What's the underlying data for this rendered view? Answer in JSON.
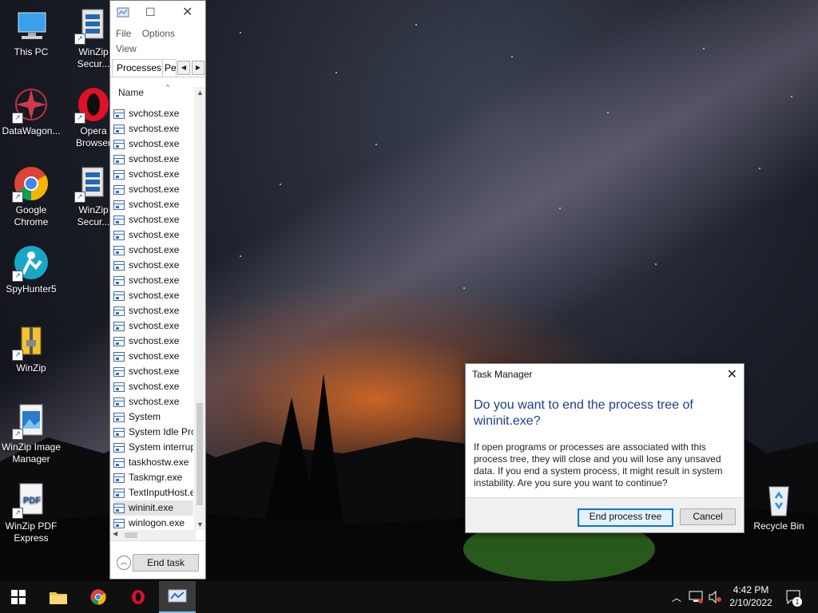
{
  "desktop": {
    "icons": [
      {
        "label": "This PC",
        "icon": "this-pc-icon"
      },
      {
        "label": "WinZip Secur...",
        "icon": "winzip-secure-icon"
      },
      {
        "label": "DataWagon...",
        "icon": "datawagon-icon"
      },
      {
        "label": "Opera Browser",
        "icon": "opera-icon"
      },
      {
        "label": "Google Chrome",
        "icon": "chrome-icon"
      },
      {
        "label": "WinZip Secur...",
        "icon": "winzip-secure-icon"
      },
      {
        "label": "SpyHunter5",
        "icon": "spyhunter-icon"
      },
      {
        "label": "WinZip",
        "icon": "winzip-icon"
      },
      {
        "label": "WinZip Image Manager",
        "icon": "winzip-image-manager-icon"
      },
      {
        "label": "WinZip PDF Express",
        "icon": "winzip-pdf-icon"
      },
      {
        "label": "Recycle Bin",
        "icon": "recycle-bin-icon"
      }
    ]
  },
  "task_manager": {
    "menu": [
      "File",
      "Options",
      "View"
    ],
    "tabs": [
      "Processes",
      "Pe"
    ],
    "column_name": "Name",
    "processes": [
      "svchost.exe",
      "svchost.exe",
      "svchost.exe",
      "svchost.exe",
      "svchost.exe",
      "svchost.exe",
      "svchost.exe",
      "svchost.exe",
      "svchost.exe",
      "svchost.exe",
      "svchost.exe",
      "svchost.exe",
      "svchost.exe",
      "svchost.exe",
      "svchost.exe",
      "svchost.exe",
      "svchost.exe",
      "svchost.exe",
      "svchost.exe",
      "svchost.exe",
      "System",
      "System Idle Pro",
      "System interrup",
      "taskhostw.exe",
      "Taskmgr.exe",
      "TextInputHost.e",
      "wininit.exe",
      "winlogon.exe"
    ],
    "selected_process": "wininit.exe",
    "end_task_label": "End task"
  },
  "dialog": {
    "title": "Task Manager",
    "heading": "Do you want to end the process tree of wininit.exe?",
    "body": "If open programs or processes are associated with this process tree, they will close and you will lose any unsaved data. If you end a system process, it might result in system instability. Are you sure you want to continue?",
    "confirm_label": "End process tree",
    "cancel_label": "Cancel"
  },
  "taskbar": {
    "apps": [
      "start-icon",
      "file-explorer-icon",
      "chrome-icon",
      "opera-icon",
      "task-manager-icon"
    ],
    "time": "4:42 PM",
    "date": "2/10/2022",
    "notification_count": "1"
  },
  "colors": {
    "dialog_heading": "#1e3d8f",
    "primary_button_border": "#0078d7",
    "taskbar": "#101010",
    "selected_row": "#e5e5e5"
  }
}
